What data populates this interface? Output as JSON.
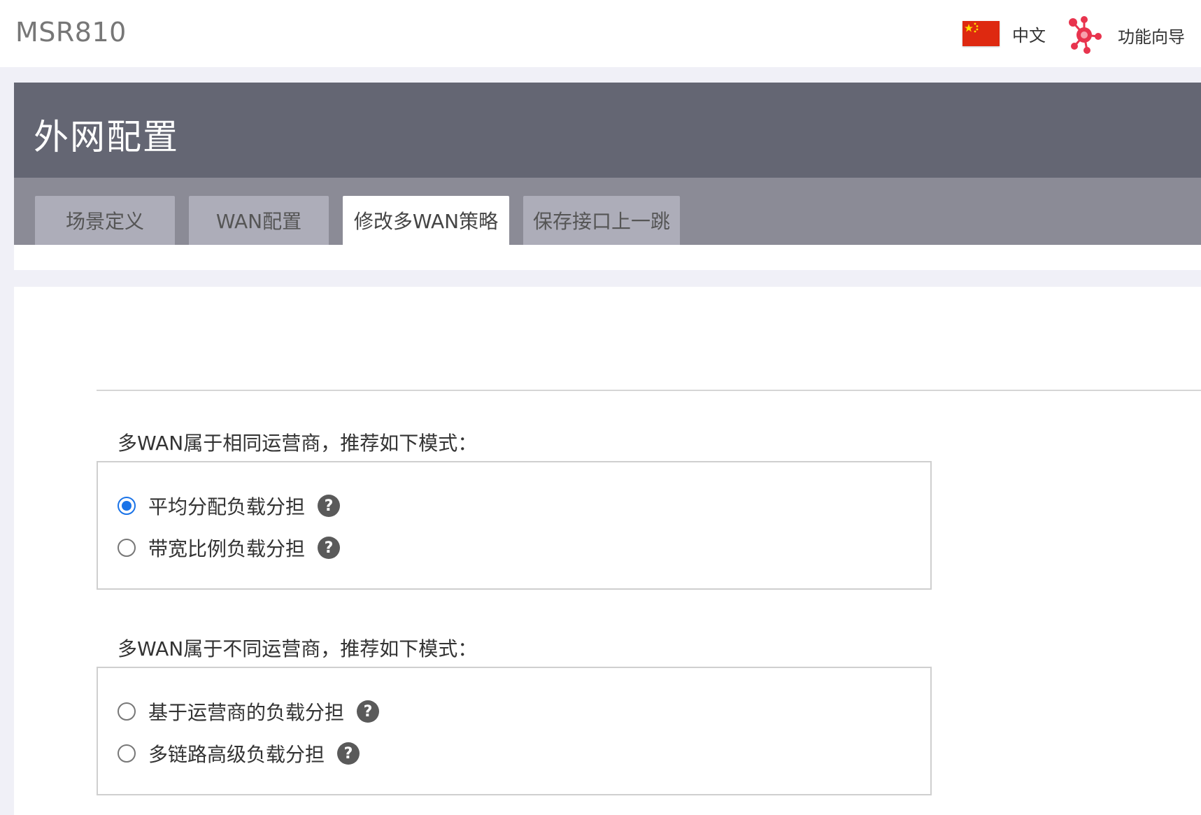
{
  "app": {
    "brand": "MSR810",
    "language_label": "中文",
    "wizard_label": "功能向导"
  },
  "page": {
    "title": "外网配置"
  },
  "tabs": [
    {
      "label": "场景定义",
      "active": false
    },
    {
      "label": "WAN配置",
      "active": false
    },
    {
      "label": "修改多WAN策略",
      "active": true
    },
    {
      "label": "保存接口上一跳",
      "active": false
    }
  ],
  "same_isp": {
    "heading": "多WAN属于相同运营商，推荐如下模式：",
    "options": [
      {
        "label": "平均分配负载分担",
        "checked": true,
        "help": "?"
      },
      {
        "label": "带宽比例负载分担",
        "checked": false,
        "help": "?"
      }
    ]
  },
  "different_isp": {
    "heading": "多WAN属于不同运营商，推荐如下模式：",
    "options": [
      {
        "label": "基于运营商的负载分担",
        "checked": false,
        "help": "?"
      },
      {
        "label": "多链路高级负载分担",
        "checked": false,
        "help": "?"
      }
    ]
  },
  "colors": {
    "header_band": "#646673",
    "tab_band": "#8b8b96",
    "tab_inactive": "#adadb9",
    "radio_checked": "#1a73e8",
    "wizard_icon": "#e8344e",
    "flag_red": "#de2910",
    "flag_star": "#ffde00"
  },
  "icons": {
    "language": "china-flag-icon",
    "wizard": "molecule-wizard-icon",
    "help": "question-mark-icon"
  }
}
